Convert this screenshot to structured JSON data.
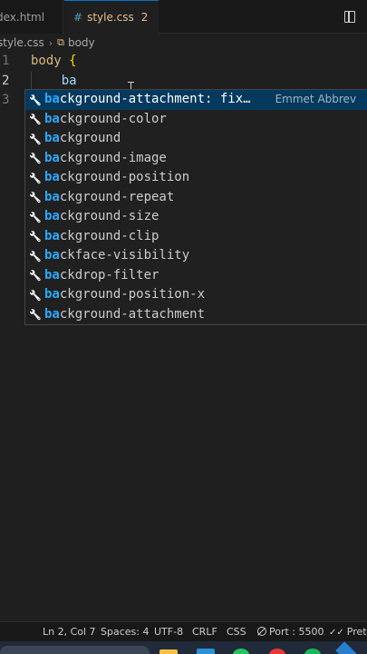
{
  "tabs": [
    {
      "label": "dex.html"
    },
    {
      "label": "style.css",
      "problems": "2",
      "icon": "css-file-icon"
    }
  ],
  "breadcrumb": {
    "file": "style.css",
    "symbol": "body"
  },
  "editor": {
    "line_numbers": [
      "1",
      "2",
      "3"
    ],
    "lines": {
      "l1_selector": "body",
      "l1_brace": " {",
      "l2_text": "ba"
    }
  },
  "suggestions": {
    "query": "ba",
    "focused_detail": "Emmet Abbrev",
    "items": [
      {
        "match": "ba",
        "rest": "ckground-attachment: fix…"
      },
      {
        "match": "ba",
        "rest": "ckground-color"
      },
      {
        "match": "ba",
        "rest": "ckground"
      },
      {
        "match": "ba",
        "rest": "ckground-image"
      },
      {
        "match": "ba",
        "rest": "ckground-position"
      },
      {
        "match": "ba",
        "rest": "ckground-repeat"
      },
      {
        "match": "ba",
        "rest": "ckground-size"
      },
      {
        "match": "ba",
        "rest": "ckground-clip"
      },
      {
        "match": "ba",
        "rest": "ckface-visibility"
      },
      {
        "match": "ba",
        "rest": "ckdrop-filter"
      },
      {
        "match": "ba",
        "rest": "ckground-position-x"
      },
      {
        "match": "ba",
        "rest": "ckground-attachment"
      }
    ]
  },
  "status": {
    "cursor": "Ln 2, Col 7",
    "spaces": "Spaces: 4",
    "encoding": "UTF-8",
    "eol": "CRLF",
    "language": "CSS",
    "port": "Port : 5500",
    "prettier": "Pretti"
  },
  "colors": {
    "accent": "#0078d4",
    "suggest_focus": "#04395e",
    "match_highlight": "#2aaaff"
  }
}
